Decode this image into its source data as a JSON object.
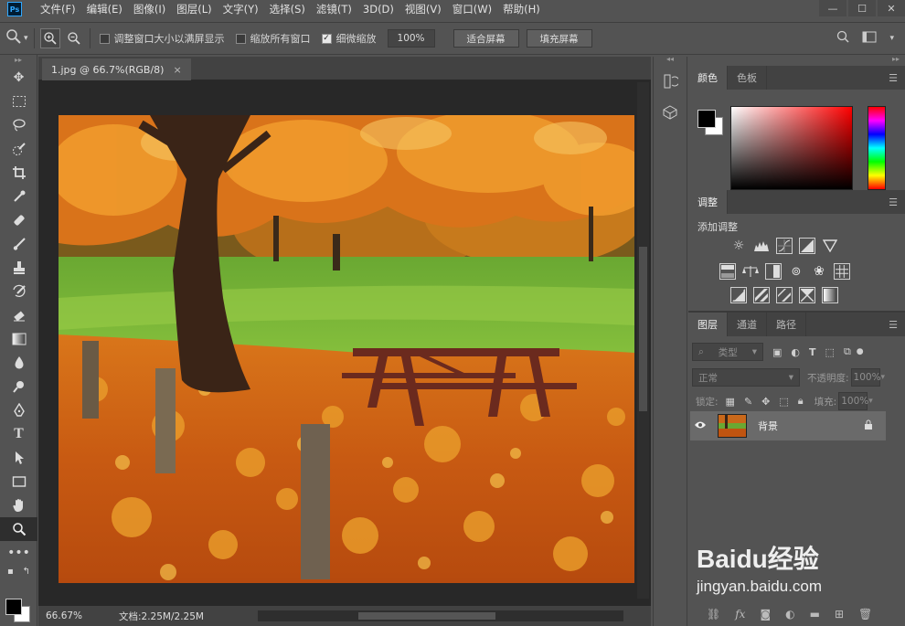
{
  "app": {
    "logo": "Ps",
    "menu": [
      "文件(F)",
      "编辑(E)",
      "图像(I)",
      "图层(L)",
      "文字(Y)",
      "选择(S)",
      "滤镜(T)",
      "3D(D)",
      "视图(V)",
      "窗口(W)",
      "帮助(H)"
    ],
    "window_controls": [
      "—",
      "☐",
      "✕"
    ]
  },
  "options": {
    "resize_windows_label": "调整窗口大小以满屏显示",
    "resize_windows_checked": false,
    "zoom_all_label": "缩放所有窗口",
    "zoom_all_checked": false,
    "scrubby_zoom_label": "细微缩放",
    "scrubby_zoom_checked": true,
    "zoom_value": "100%",
    "fit_screen_label": "适合屏幕",
    "fill_screen_label": "填充屏幕"
  },
  "document": {
    "tab_title": "1.jpg @ 66.7%(RGB/8)",
    "tab_close": "×",
    "status_zoom": "66.67%",
    "status_doc": "文档:2.25M/2.25M"
  },
  "panels": {
    "color_tabs": [
      "颜色",
      "色板"
    ],
    "adjustments_tab": "调整",
    "adjustments_title": "添加调整",
    "layers_tabs": [
      "图层",
      "通道",
      "路径"
    ],
    "filter_type": "类型",
    "blend_mode": "正常",
    "opacity_label": "不透明度:",
    "opacity_value": "100%",
    "lock_label": "锁定:",
    "fill_label": "填充:",
    "fill_value": "100%",
    "layer_name": "背景"
  },
  "colors": {
    "foreground": "#000000",
    "background": "#ffffff",
    "accent": "#31a8ff"
  },
  "watermark": {
    "brand": "Baidu经验",
    "url": "jingyan.baidu.com"
  }
}
